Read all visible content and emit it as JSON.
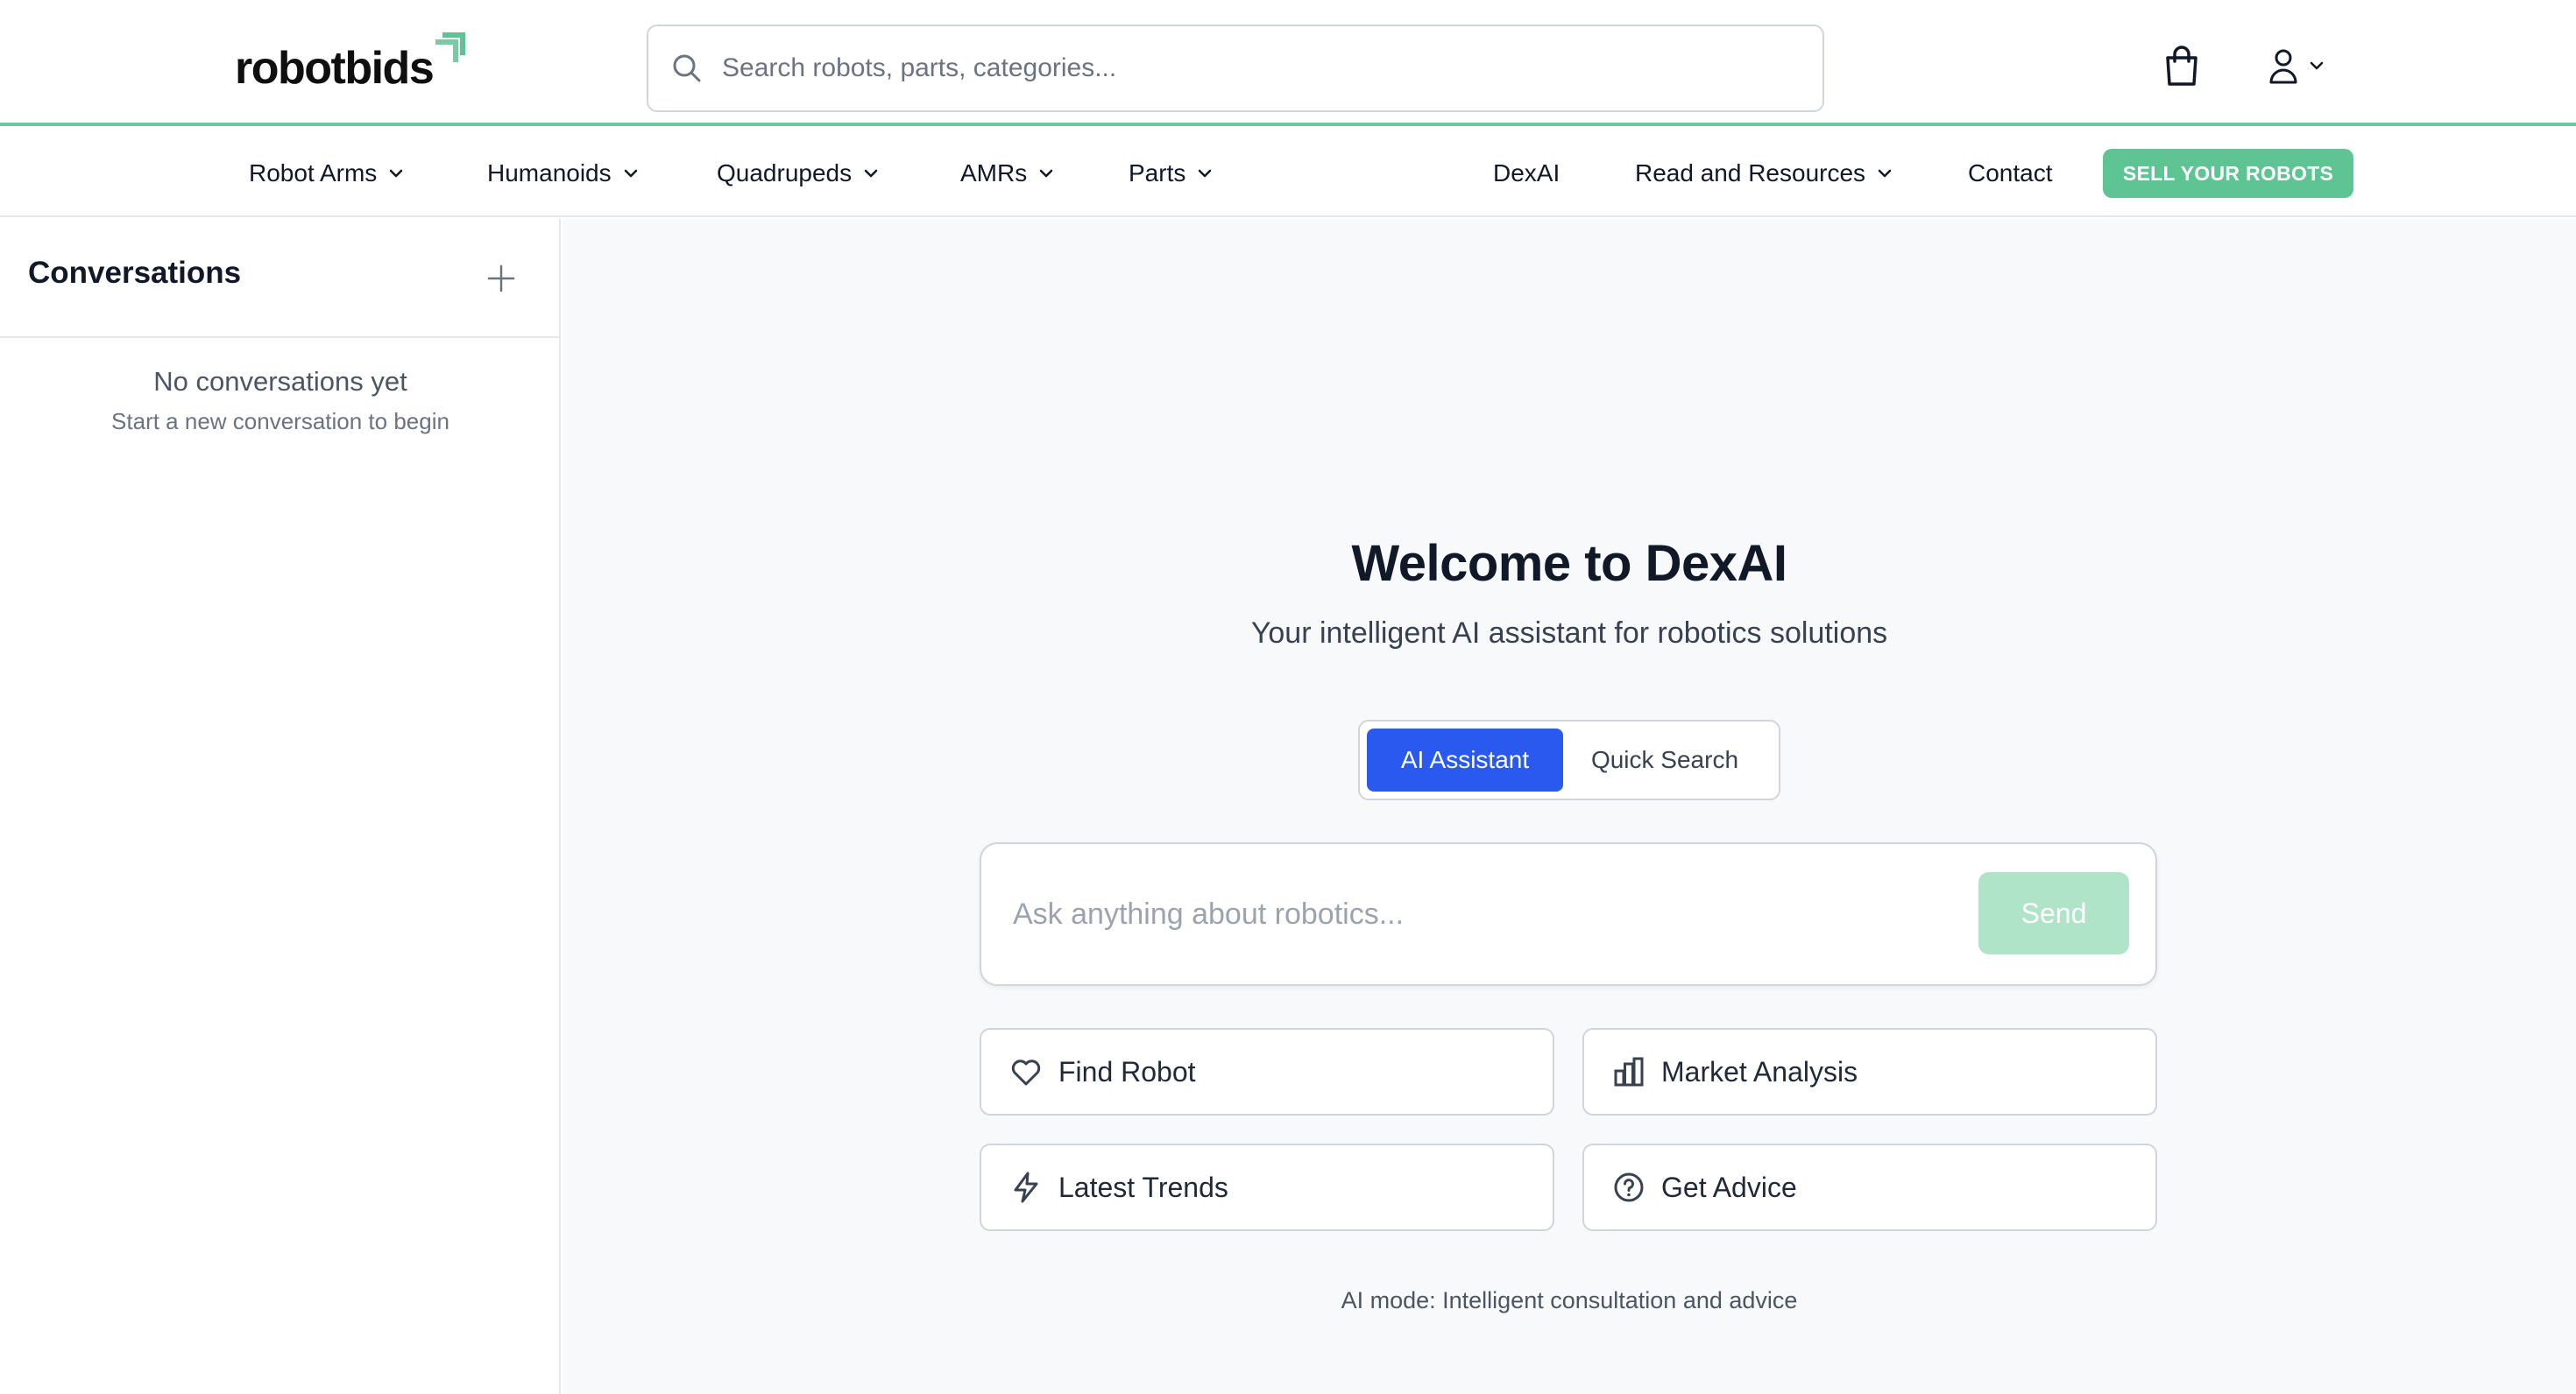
{
  "brand": {
    "name": "robotbids",
    "accent_color": "#5fc493"
  },
  "header": {
    "search_placeholder": "Search robots, parts, categories...",
    "cart_icon": "shopping-bag-icon",
    "user_icon": "user-icon"
  },
  "nav": {
    "items": [
      {
        "label": "Robot Arms",
        "has_dropdown": true
      },
      {
        "label": "Humanoids",
        "has_dropdown": true
      },
      {
        "label": "Quadrupeds",
        "has_dropdown": true
      },
      {
        "label": "AMRs",
        "has_dropdown": true
      },
      {
        "label": "Parts",
        "has_dropdown": true
      },
      {
        "label": "DexAI",
        "has_dropdown": false
      },
      {
        "label": "Read and Resources",
        "has_dropdown": true
      },
      {
        "label": "Contact",
        "has_dropdown": false
      }
    ],
    "sell_button": "SELL YOUR ROBOTS"
  },
  "sidebar": {
    "title": "Conversations",
    "new_icon": "plus-icon",
    "empty_title": "No conversations yet",
    "empty_subtitle": "Start a new conversation to begin"
  },
  "main": {
    "title": "Welcome to DexAI",
    "subtitle": "Your intelligent AI assistant for robotics solutions",
    "modes": {
      "active": "AI Assistant",
      "inactive": "Quick Search"
    },
    "input_placeholder": "Ask anything about robotics...",
    "send_label": "Send",
    "actions": [
      {
        "label": "Find Robot",
        "icon": "heart-icon"
      },
      {
        "label": "Market Analysis",
        "icon": "bar-chart-icon"
      },
      {
        "label": "Latest Trends",
        "icon": "lightning-icon"
      },
      {
        "label": "Get Advice",
        "icon": "help-circle-icon"
      }
    ],
    "mode_note": "AI mode: Intelligent consultation and advice",
    "primary_color": "#2a59f0"
  }
}
